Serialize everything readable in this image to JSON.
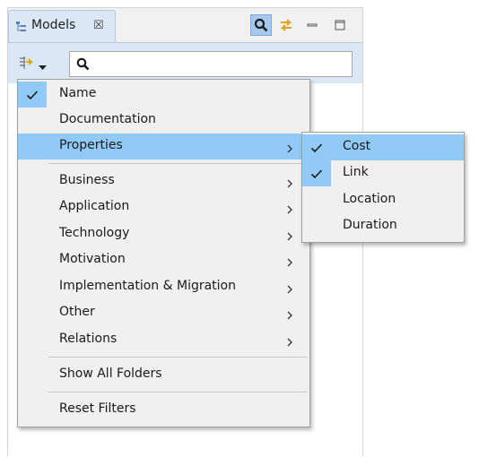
{
  "view_tab": {
    "title": "Models",
    "close_glyph": "☒"
  },
  "toolbar": {
    "search_icon": "search-icon",
    "sync_icon": "link-with-editor-icon",
    "minimize_icon": "minimize-icon",
    "maximize_icon": "maximize-icon"
  },
  "search": {
    "value": "",
    "placeholder": ""
  },
  "filter_menu": {
    "items": [
      {
        "label": "Name",
        "checked": true
      },
      {
        "label": "Documentation",
        "checked": false
      },
      {
        "label": "Properties",
        "checked": false,
        "submenu": true,
        "highlighted": true
      },
      {
        "label": "Business",
        "submenu": true
      },
      {
        "label": "Application",
        "submenu": true
      },
      {
        "label": "Technology",
        "submenu": true
      },
      {
        "label": "Motivation",
        "submenu": true
      },
      {
        "label": "Implementation & Migration",
        "submenu": true
      },
      {
        "label": "Other",
        "submenu": true
      },
      {
        "label": "Relations",
        "submenu": true
      },
      {
        "label": "Show All Folders"
      },
      {
        "label": "Reset Filters"
      }
    ]
  },
  "properties_submenu": {
    "items": [
      {
        "label": "Cost",
        "checked": true,
        "highlighted": true
      },
      {
        "label": "Link",
        "checked": true
      },
      {
        "label": "Location",
        "checked": false
      },
      {
        "label": "Duration",
        "checked": false
      }
    ]
  },
  "colors": {
    "highlight": "#91c9f7",
    "tab_active": "#dce7f5",
    "menu_bg": "#f0f0f0"
  }
}
